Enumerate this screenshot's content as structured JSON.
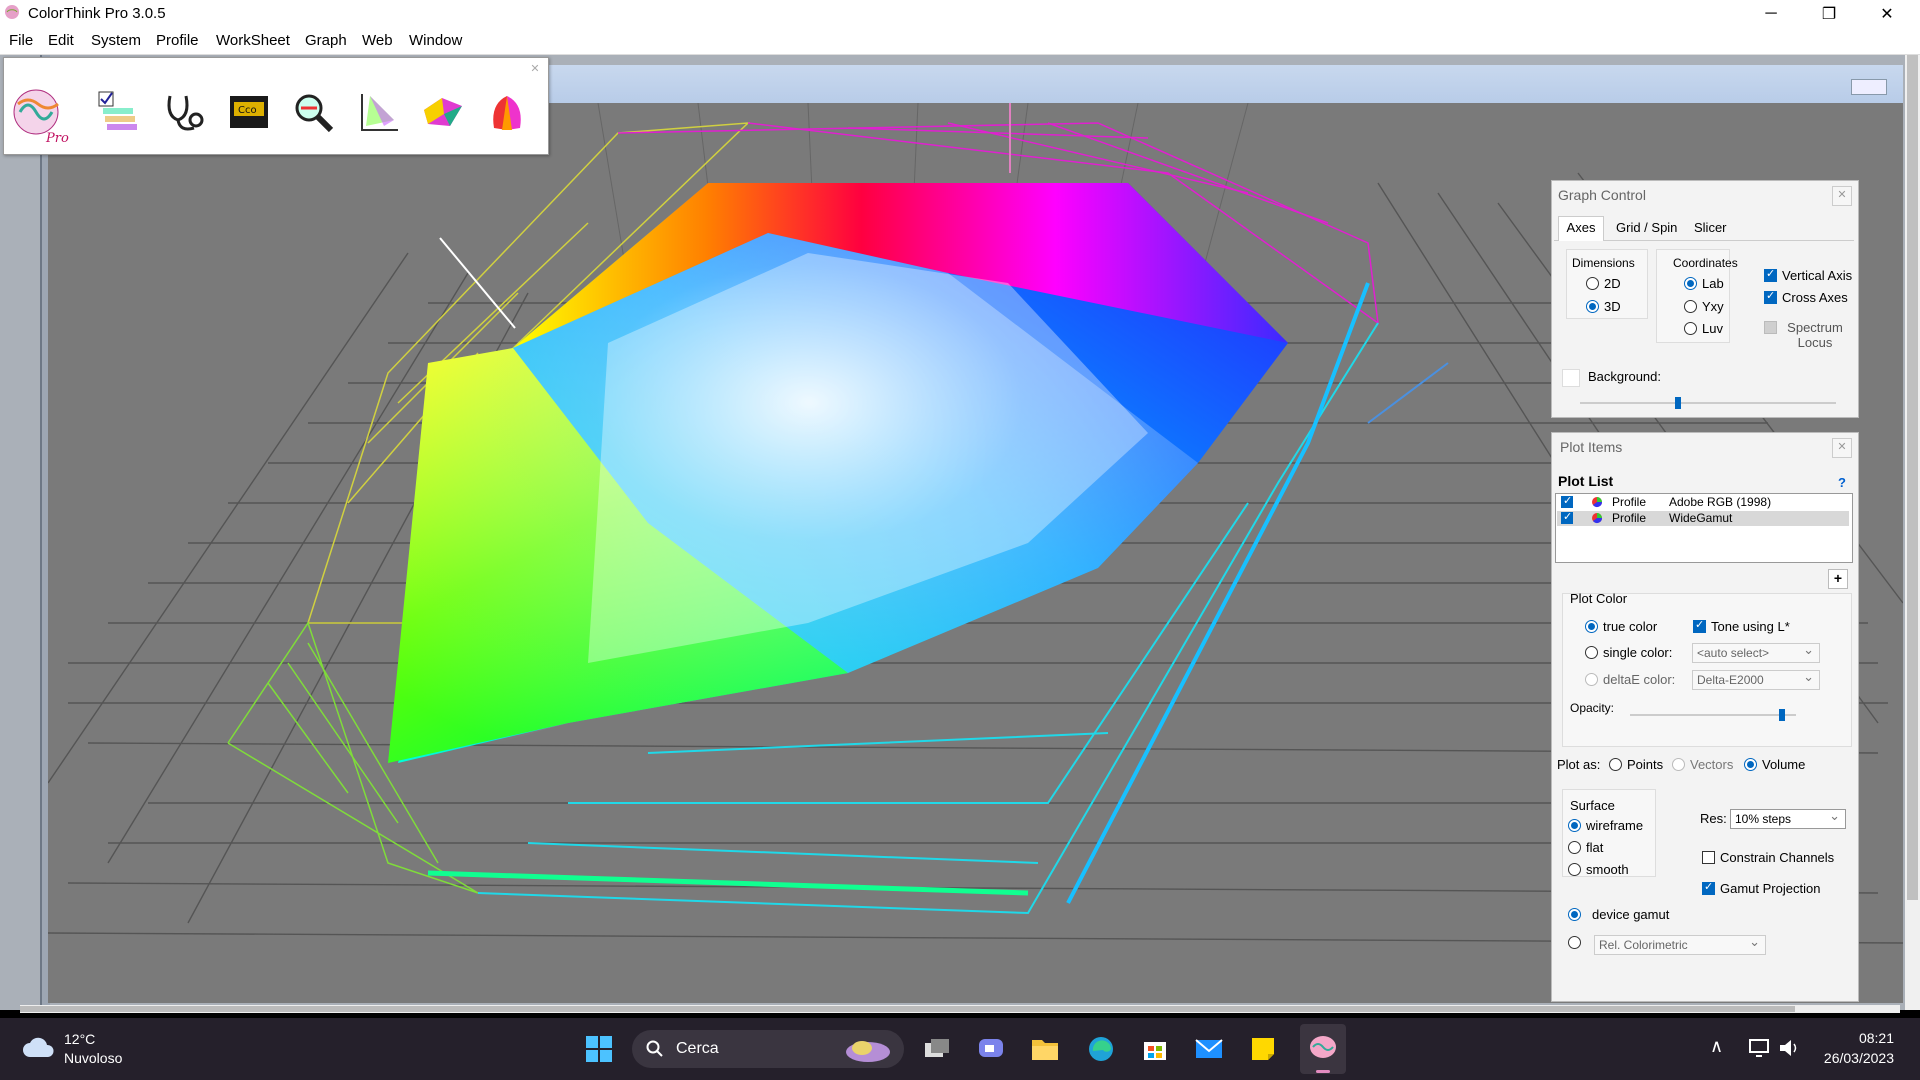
{
  "window": {
    "title": "ColorThink Pro 3.0.5"
  },
  "menu": [
    "File",
    "Edit",
    "System",
    "Profile",
    "WorkSheet",
    "Graph",
    "Web",
    "Window"
  ],
  "toolbar": {
    "tools": [
      "colorthink-pro-logo-icon",
      "profile-inspector-icon",
      "profile-doctor-icon",
      "color-worksheet-icon",
      "profile-inspector-magnifier-icon",
      "graph-gamut-icon",
      "gamut-3d-icon",
      "color-wheel-icon"
    ]
  },
  "graph_control": {
    "title": "Graph Control",
    "tabs": [
      "Axes",
      "Grid / Spin",
      "Slicer"
    ],
    "active_tab": "Axes",
    "dimensions": {
      "label": "Dimensions",
      "options": [
        "2D",
        "3D"
      ],
      "selected": "3D"
    },
    "coordinates": {
      "label": "Coordinates",
      "options": [
        "Lab",
        "Yxy",
        "Luv"
      ],
      "selected": "Lab"
    },
    "checks": [
      {
        "label": "Vertical Axis",
        "checked": true,
        "enabled": true
      },
      {
        "label": "Cross Axes",
        "checked": true,
        "enabled": true
      },
      {
        "label": "Spectrum Locus",
        "checked": true,
        "enabled": false
      }
    ],
    "background_label": "Background:",
    "background_level": 0.38
  },
  "plot_items": {
    "title": "Plot Items",
    "plot_list_label": "Plot List",
    "help": "?",
    "add": "+",
    "items": [
      {
        "type": "Profile",
        "name": "Adobe RGB (1998)",
        "checked": true,
        "selected": false
      },
      {
        "type": "Profile",
        "name": "WideGamut",
        "checked": true,
        "selected": true
      }
    ],
    "plot_color": {
      "label": "Plot Color",
      "true_color": "true color",
      "single_color": "single color:",
      "deltae_color": "deltaE color:",
      "selected": "true color",
      "tone_label": "Tone using L*",
      "tone_checked": true,
      "single_select": "<auto select>",
      "deltae_select": "Delta-E2000",
      "opacity_label": "Opacity:",
      "opacity_level": 0.93
    },
    "plot_as": {
      "label": "Plot as:",
      "options": [
        "Points",
        "Vectors",
        "Volume"
      ],
      "selected": "Volume"
    },
    "surface": {
      "label": "Surface",
      "options": [
        "wireframe",
        "flat",
        "smooth"
      ],
      "selected": "wireframe"
    },
    "res_label": "Res:",
    "res_value": "10% steps",
    "constrain": {
      "label": "Constrain Channels",
      "checked": false
    },
    "gamut_projection": {
      "label": "Gamut Projection",
      "checked": true
    },
    "device_gamut": "device gamut",
    "rel_colorimetric": "Rel. Colorimetric"
  },
  "taskbar": {
    "weather_temp": "12°C",
    "weather_desc": "Nuvoloso",
    "search_label": "Cerca",
    "time": "08:21",
    "date": "26/03/2023"
  }
}
